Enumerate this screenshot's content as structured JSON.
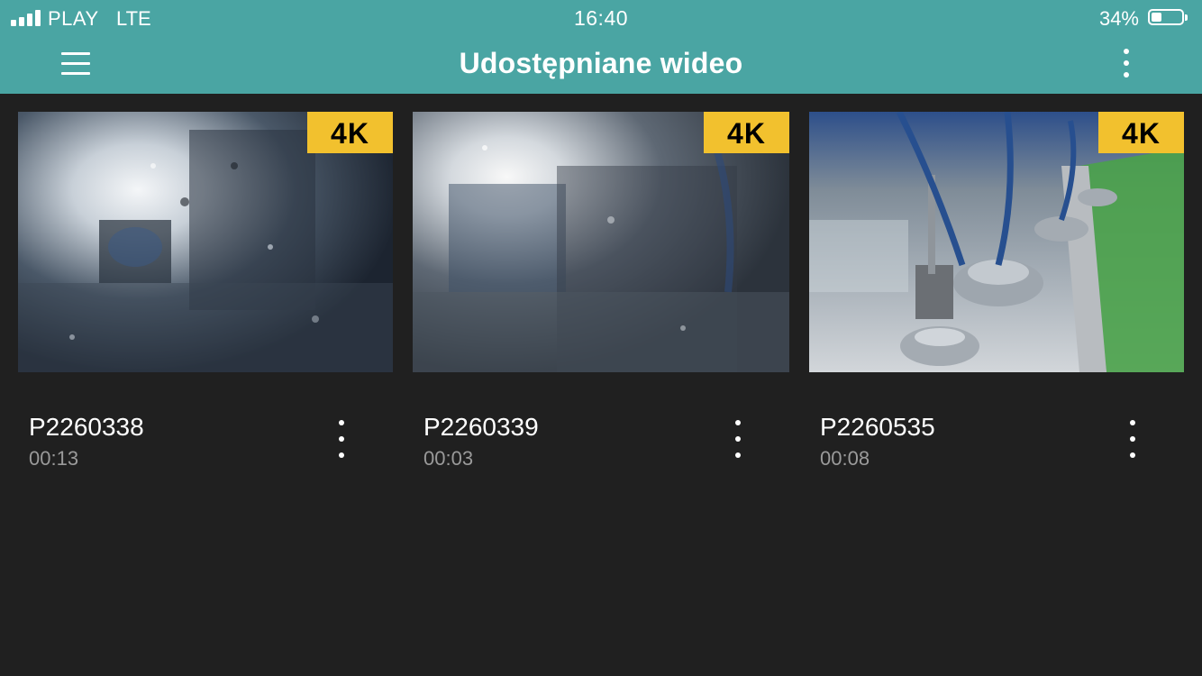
{
  "status_bar": {
    "carrier": "PLAY",
    "network": "LTE",
    "time": "16:40",
    "battery_percent": "34%",
    "battery_level": 0.34,
    "signal_bars": 4
  },
  "app_bar": {
    "title": "Udostępniane wideo",
    "menu_icon": "hamburger-menu-icon",
    "more_icon": "more-vertical-icon"
  },
  "videos": [
    {
      "name": "P2260338",
      "duration": "00:13",
      "badge": "4K"
    },
    {
      "name": "P2260339",
      "duration": "00:03",
      "badge": "4K"
    },
    {
      "name": "P2260535",
      "duration": "00:08",
      "badge": "4K"
    }
  ],
  "colors": {
    "header": "#4aa5a3",
    "background": "#202020",
    "badge": "#f2c12e",
    "duration_text": "#9a9a9a"
  }
}
